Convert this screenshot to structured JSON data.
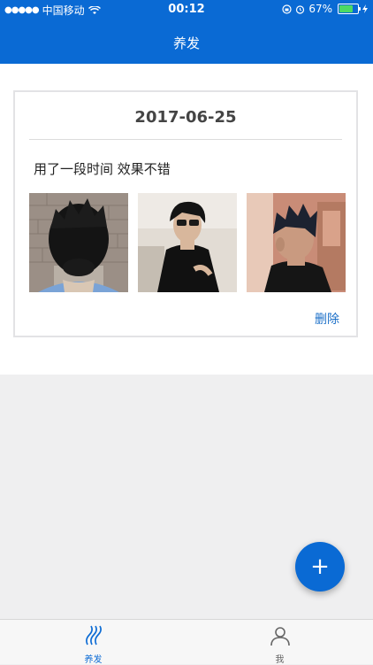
{
  "status_bar": {
    "carrier": "中国移动",
    "time": "00:12",
    "battery": "67%",
    "battery_level": 0.67
  },
  "header": {
    "title": "养发"
  },
  "card": {
    "date": "2017-06-25",
    "text": "用了一段时间 效果不错",
    "delete_label": "删除"
  },
  "fab": {
    "label": "+"
  },
  "tabbar": {
    "tabs": [
      {
        "label": "养发",
        "active": true
      },
      {
        "label": "我",
        "active": false
      }
    ]
  },
  "colors": {
    "primary": "#0a6ad4",
    "link": "#1b6fc8",
    "background": "#efeff0"
  }
}
